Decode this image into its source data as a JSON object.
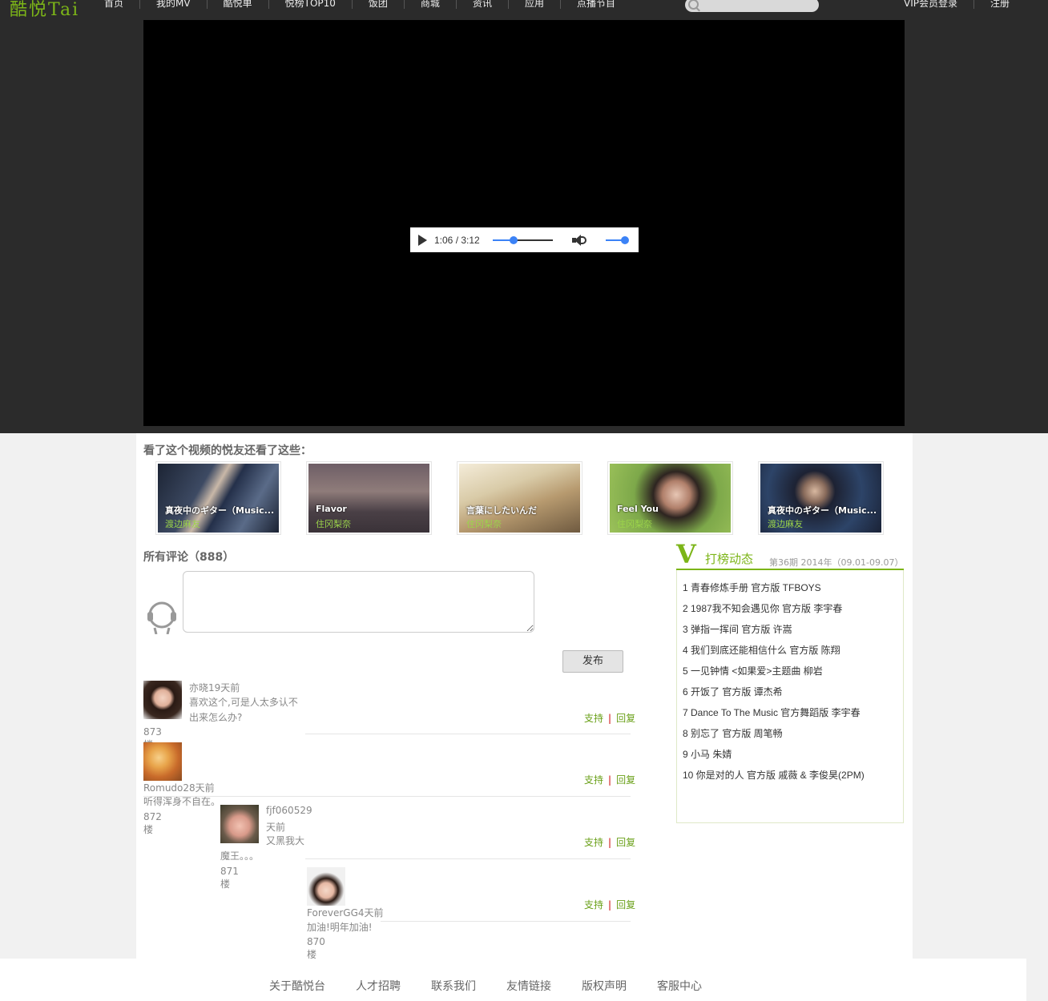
{
  "site": {
    "logo": "酷悦Tai"
  },
  "nav": {
    "items": [
      "首页",
      "我的MV",
      "酷悦单",
      "悦榜TOP10",
      "饭团",
      "商城",
      "资讯",
      "应用",
      "点播节目"
    ],
    "user_links": [
      "VIP会员登录",
      "注册"
    ]
  },
  "player": {
    "time": "1:06 / 3:12",
    "progress": 0.35,
    "volume": 1.0
  },
  "related": {
    "title": "看了这个视频的悦友还看了这些：",
    "items": [
      {
        "title": "真夜中のギター（Music...",
        "artist": "渡边麻友"
      },
      {
        "title": "Flavor",
        "artist": "住冈梨奈"
      },
      {
        "title": "言葉にしたいんだ",
        "artist": "住冈梨奈"
      },
      {
        "title": "Feel You",
        "artist": "住冈梨奈"
      },
      {
        "title": "真夜中のギター（Music...",
        "artist": "渡边麻友"
      }
    ]
  },
  "comments": {
    "title": "所有评论（888）",
    "publish_label": "发布",
    "support_label": "支持",
    "sep": "|",
    "reply_label": "回复",
    "list": [
      {
        "name": "亦晓19天前",
        "text": "喜欢这个,可是人太多认不出来怎么办?",
        "floor": "873楼"
      },
      {
        "name": "Romudo28天前",
        "text": "听得浑身不自在。",
        "floor": "872楼"
      },
      {
        "name": "fjf060529",
        "time": "天前",
        "text": "又黑我大魔王。。。",
        "floor": "871楼"
      },
      {
        "name": "ForeverGG4天前",
        "text": "加油!明年加油!",
        "floor": "870楼"
      }
    ]
  },
  "chart": {
    "logo": "V",
    "title": "打榜动态",
    "period": "第36期 2014年（09.01-09.07）",
    "items": [
      "1 青春修炼手册 官方版 TFBOYS",
      "2 1987我不知会遇见你 官方版 李宇春",
      "3 弹指一挥间 官方版 许嵩",
      "4 我们到底还能相信什么 官方版 陈翔",
      "5 一见钟情 <如果爱>主题曲 柳岩",
      "6 开饭了 官方版 谭杰希",
      "7 Dance To The Music 官方舞蹈版 李宇春",
      "8 别忘了 官方版 周笔畅",
      "9 小马 朱婧",
      "10 你是对的人 官方版 戚薇 & 李俊昊(2PM)"
    ]
  },
  "footer": {
    "links": [
      "关于酷悦台",
      "人才招聘",
      "联系我们",
      "友情链接",
      "版权声明",
      "客服中心"
    ]
  }
}
